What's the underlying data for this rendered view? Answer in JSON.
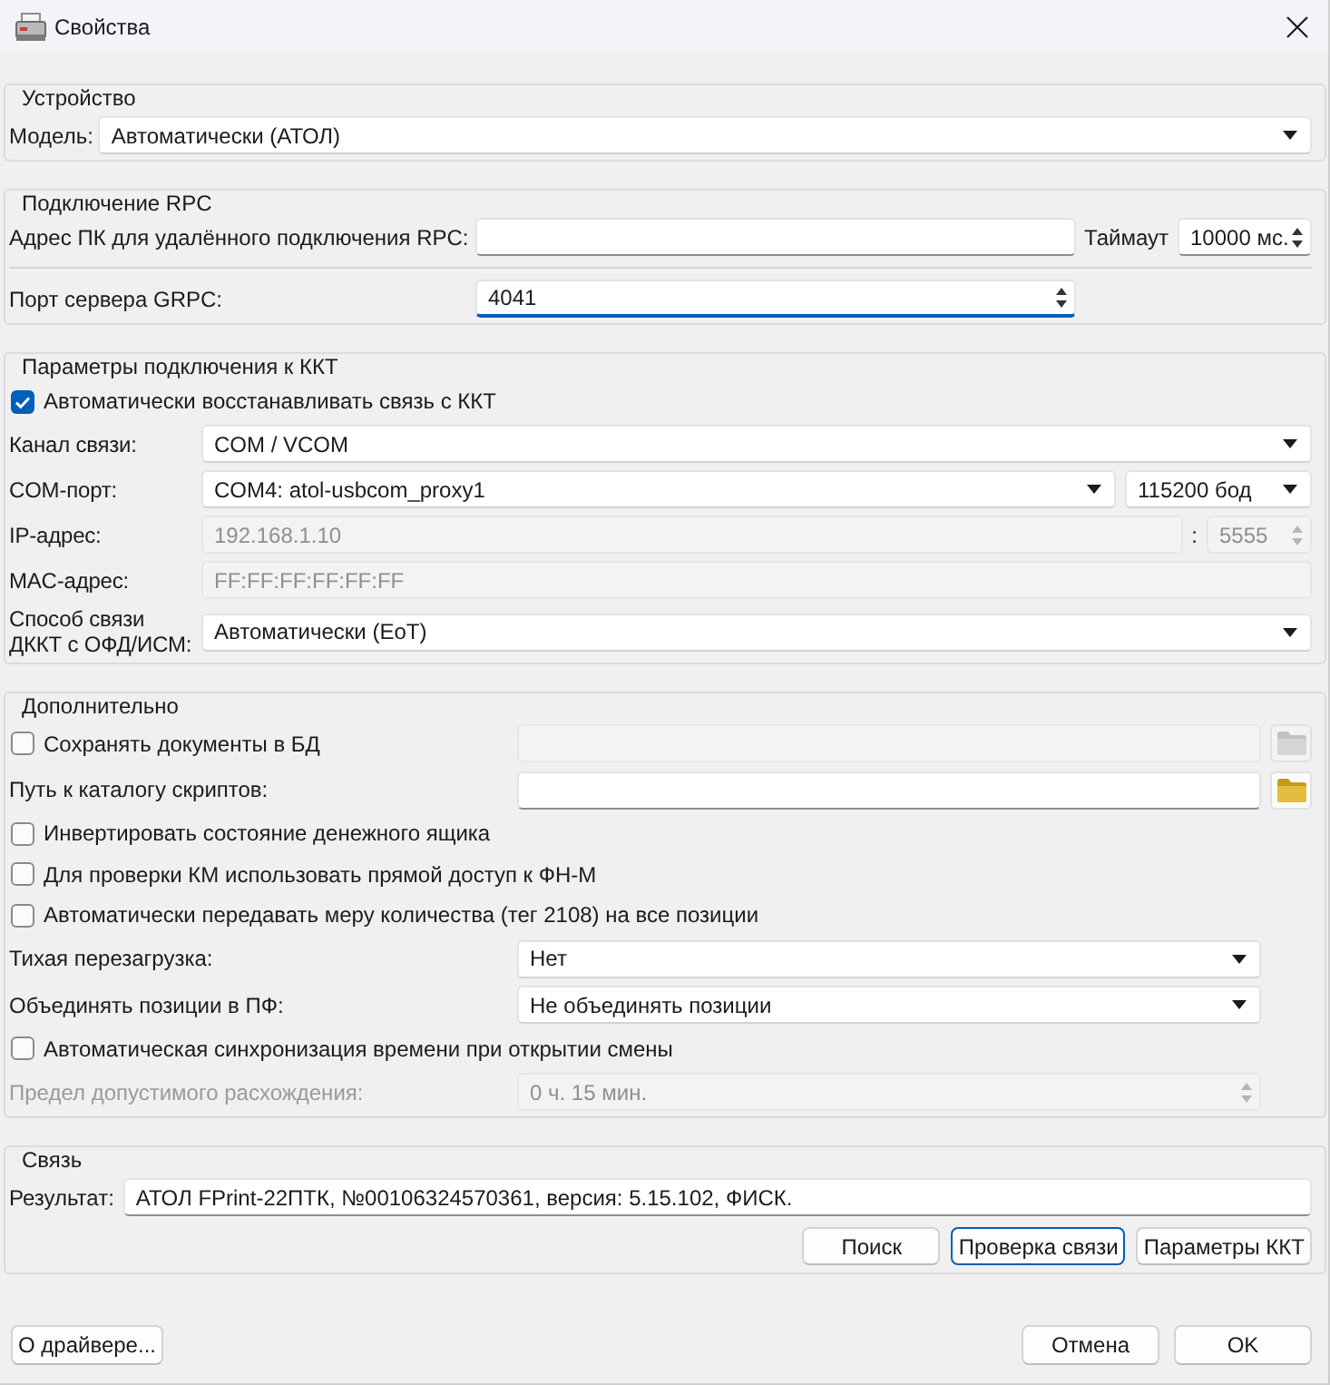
{
  "window": {
    "title": "Свойства"
  },
  "sections": [
    {
      "kind": "device",
      "title": "Устройство",
      "rows": [
        {
          "kind": "field",
          "label": "Модель:",
          "fields": [
            {
              "kind": "combo",
              "value": "Автоматически (АТОЛ)"
            }
          ]
        }
      ]
    },
    {
      "kind": "rpc",
      "title": "Подключение RPC",
      "rows": [
        {
          "kind": "field",
          "label": "Адрес ПК для удалённого подключения RPC:",
          "fields": [
            {
              "kind": "input"
            },
            {
              "kind": "text",
              "text": "Таймаут"
            },
            {
              "kind": "spin",
              "value": "10000 мс."
            }
          ]
        },
        {
          "kind": "field",
          "label": "Порт сервера GRPC:",
          "fields": [
            {
              "kind": "spin",
              "value": "4041",
              "focused": true
            }
          ]
        }
      ]
    },
    {
      "kind": "kkt",
      "title": "Параметры подключения к ККТ",
      "rows": [
        {
          "kind": "check",
          "label": "Автоматически восстанавливать связь с ККТ",
          "checked": true
        },
        {
          "kind": "field",
          "label": "Канал связи:",
          "fields": [
            {
              "kind": "combo",
              "value": "COM / VCOM"
            }
          ]
        },
        {
          "kind": "field",
          "label": "COM-порт:",
          "fields": [
            {
              "kind": "combo",
              "value": "COM4: atol-usbcom_proxy1"
            },
            {
              "kind": "combo",
              "value": "115200 бод"
            }
          ]
        },
        {
          "kind": "field",
          "label": "IP-адрес:",
          "fields": [
            {
              "kind": "input",
              "value": "192.168.1.10",
              "disabled": true
            },
            {
              "kind": "text",
              "text": ":"
            },
            {
              "kind": "spin",
              "value": "5555",
              "disabled": true
            }
          ]
        },
        {
          "kind": "field",
          "label": "MAC-адрес:",
          "fields": [
            {
              "kind": "input",
              "value": "FF:FF:FF:FF:FF:FF",
              "disabled": true
            }
          ]
        },
        {
          "kind": "field",
          "label": "Способ связи ДККТ с ОФД/ИСМ:",
          "fields": [
            {
              "kind": "combo",
              "value": "Автоматически (EoT)"
            }
          ]
        }
      ]
    },
    {
      "kind": "extra",
      "title": "Дополнительно",
      "rows": [
        {
          "kind": "check",
          "label": "Сохранять документы в БД",
          "checked": false,
          "fields": [
            {
              "kind": "input",
              "disabled": true
            },
            {
              "kind": "folder",
              "disabled": true
            }
          ]
        },
        {
          "kind": "field",
          "label": "Путь к каталогу скриптов:",
          "fields": [
            {
              "kind": "input"
            },
            {
              "kind": "folder"
            }
          ]
        },
        {
          "kind": "check",
          "label": "Инвертировать состояние денежного ящика",
          "checked": false
        },
        {
          "kind": "check",
          "label": "Для проверки КМ использовать прямой доступ к ФН-М",
          "checked": false
        },
        {
          "kind": "check",
          "label": "Автоматически передавать меру количества (тег 2108) на все позиции",
          "checked": false
        },
        {
          "kind": "field",
          "label": "Тихая перезагрузка:",
          "fields": [
            {
              "kind": "combo",
              "value": "Нет"
            }
          ]
        },
        {
          "kind": "field",
          "label": "Объединять позиции в ПФ:",
          "fields": [
            {
              "kind": "combo",
              "value": "Не объединять позиции"
            }
          ]
        },
        {
          "kind": "check",
          "label": "Автоматическая синхронизация времени при открытии смены",
          "checked": false
        },
        {
          "kind": "field",
          "label": "Предел допустимого расхождения:",
          "disabled": true,
          "fields": [
            {
              "kind": "spin",
              "value": "0 ч. 15 мин.",
              "disabled": true
            }
          ]
        }
      ]
    },
    {
      "kind": "link",
      "title": "Связь",
      "rows": [
        {
          "kind": "field",
          "label": "Результат:",
          "fields": [
            {
              "kind": "input",
              "value": "АТОЛ FPrint-22ПТК, №00106324570361, версия: 5.15.102, ФИСК."
            }
          ]
        }
      ],
      "buttons": [
        {
          "label": "Поиск",
          "focused": false
        },
        {
          "label": "Проверка связи",
          "focused": true
        },
        {
          "label": "Параметры ККТ",
          "focused": false
        }
      ]
    }
  ],
  "footer": {
    "left_buttons": [
      {
        "label": "О драйвере..."
      }
    ],
    "right_buttons": [
      {
        "label": "Отмена"
      },
      {
        "label": "OK"
      }
    ]
  }
}
